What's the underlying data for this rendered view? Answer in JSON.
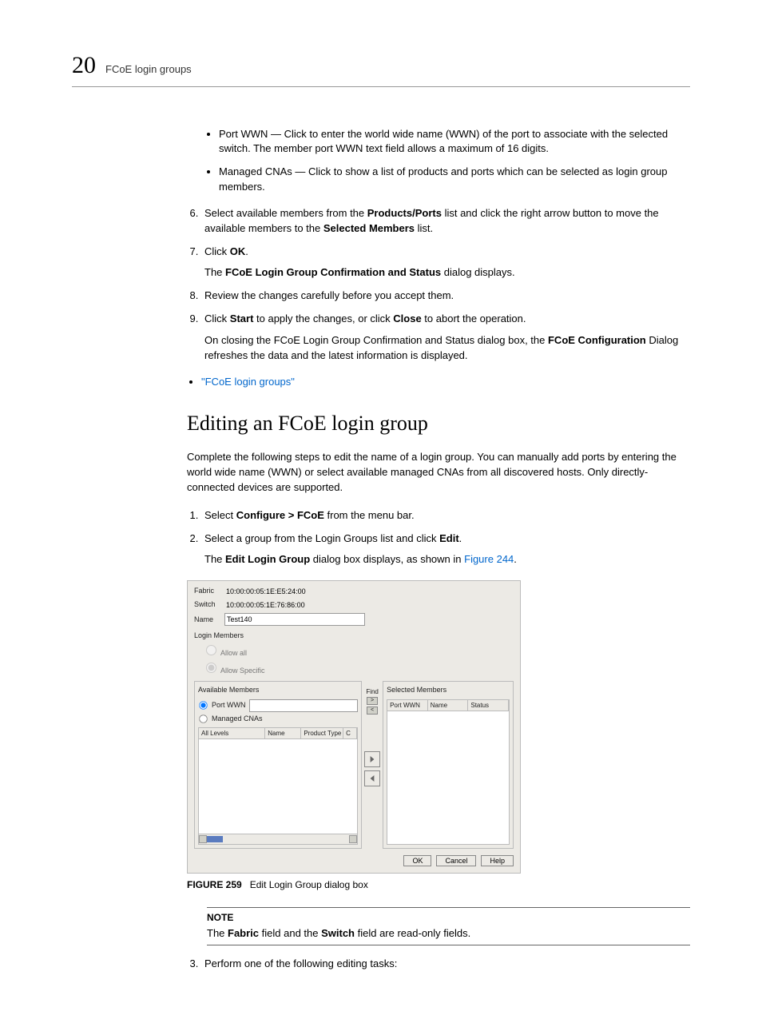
{
  "header": {
    "chapter_number": "20",
    "running_title": "FCoE login groups"
  },
  "top_bullets": [
    "Port WWN — Click to enter the world wide name (WWN) of the port to associate with the selected switch. The member port WWN text field allows a maximum of 16 digits.",
    "Managed CNAs — Click to show a list of products and ports which can be selected as login group members."
  ],
  "steps_a": {
    "start": 6,
    "items": [
      {
        "pre": "Select available members from the ",
        "b1": "Products/Ports",
        "mid": " list and click the right arrow button to move the available members to the ",
        "b2": "Selected Members",
        "post": " list."
      },
      {
        "pre": "Click ",
        "b1": "OK",
        "post": ".",
        "para_pre": "The ",
        "para_b": "FCoE Login Group Confirmation and Status",
        "para_post": " dialog displays."
      },
      {
        "text": "Review the changes carefully before you accept them."
      },
      {
        "pre": "Click ",
        "b1": "Start",
        "mid": " to apply the changes, or click ",
        "b2": "Close",
        "post": " to abort the operation.",
        "para_pre": "On closing the FCoE Login Group Confirmation and Status dialog box, the ",
        "para_b": "FCoE Configuration",
        "para_post": " Dialog refreshes the data and the latest information is displayed."
      }
    ]
  },
  "toplink": "\"FCoE login groups\"",
  "section_title": "Editing an FCoE login group",
  "intro": "Complete the following steps to edit the name of a login group. You can manually add ports by entering the world wide name (WWN) or select available managed CNAs from all discovered hosts. Only directly-connected devices are supported.",
  "steps_b": {
    "start": 1,
    "items": [
      {
        "pre": "Select ",
        "b1": "Configure > FCoE",
        "post": " from the menu bar."
      },
      {
        "pre": "Select a group from the Login Groups list and click ",
        "b1": "Edit",
        "post": ".",
        "para_pre": "The ",
        "para_b": "Edit Login Group",
        "para_mid": " dialog box displays, as shown in ",
        "para_link": "Figure 244",
        "para_post": "."
      }
    ]
  },
  "figure": {
    "label": "FIGURE 259",
    "caption": "Edit Login Group dialog box",
    "dialog": {
      "fabric_label": "Fabric",
      "fabric_value": "10:00:00:05:1E:E5:24:00",
      "switch_label": "Switch",
      "switch_value": "10:00:00:05:1E:76:86:00",
      "name_label": "Name",
      "name_value": "Test140",
      "login_members": "Login Members",
      "allow_all": "Allow all",
      "allow_specific": "Allow Specific",
      "available_members": "Available Members",
      "port_wwn": "Port WWN",
      "managed_cnas": "Managed CNAs",
      "col_all_levels": "All Levels",
      "col_name": "Name",
      "col_product_type": "Product Type",
      "col_c": "C",
      "find": "Find",
      "gt": ">",
      "lt": "<",
      "selected_members": "Selected Members",
      "sel_col_port_wwn": "Port WWN",
      "sel_col_name": "Name",
      "sel_col_status": "Status",
      "ok": "OK",
      "cancel": "Cancel",
      "help": "Help"
    }
  },
  "note": {
    "title": "NOTE",
    "pre": "The ",
    "b1": "Fabric",
    "mid": " field and the ",
    "b2": "Switch",
    "post": " field are read-only fields."
  },
  "step3": {
    "num": "3.",
    "text": "Perform one of the following editing tasks:"
  }
}
